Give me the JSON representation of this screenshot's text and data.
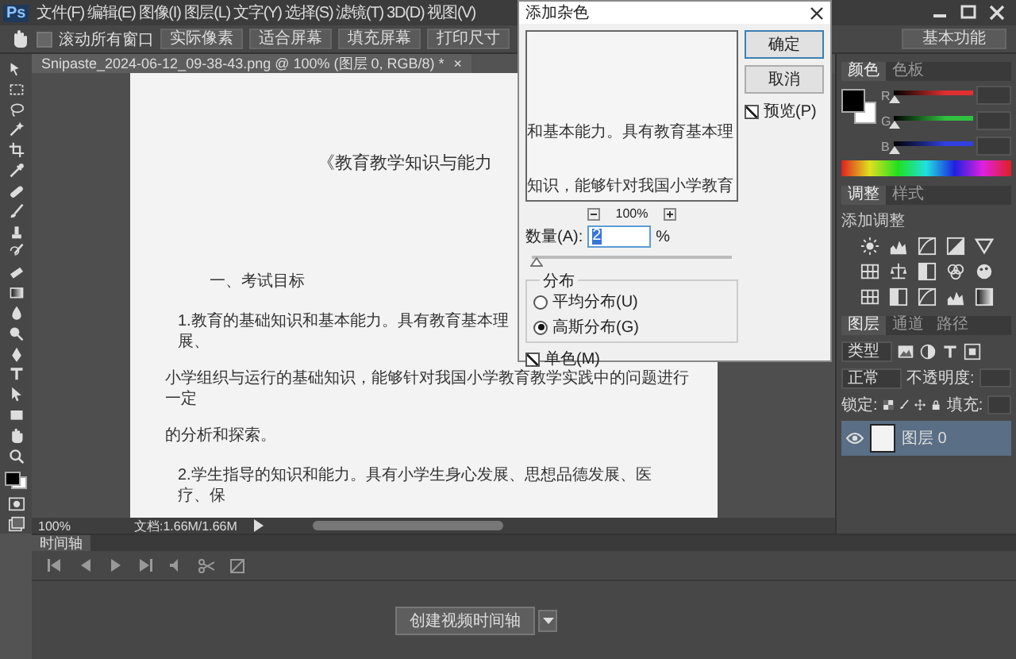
{
  "app": {
    "logo": "Ps"
  },
  "menu": [
    "文件(F)",
    "编辑(E)",
    "图像(I)",
    "图层(L)",
    "文字(Y)",
    "选择(S)",
    "滤镜(T)",
    "3D(D)",
    "视图(V)"
  ],
  "options": {
    "scroll_all": {
      "label": "滚动所有窗口",
      "checked": false
    },
    "buttons": [
      "实际像素",
      "适合屏幕",
      "填充屏幕",
      "打印尺寸"
    ],
    "workspace": "基本功能"
  },
  "document_tab": {
    "title": "Snipaste_2024-06-12_09-38-43.png @ 100% (图层 0, RGB/8) *",
    "close": "×"
  },
  "document": {
    "lines": [
      {
        "kind": "title",
        "text": "《教育教学知识与能力"
      },
      {
        "kind": "heading",
        "text": "一、考试目标"
      },
      {
        "kind": "item",
        "text": "1.教育的基础知识和基本能力。具有教育基本理"
      },
      {
        "kind": "wrap",
        "text": "展、"
      },
      {
        "kind": "body",
        "text": "小学组织与运行的基础知识，能够针对我国小学教育教学实践中的问题进行"
      },
      {
        "kind": "body_wrap",
        "text": "一定"
      },
      {
        "kind": "body",
        "text": "的分析和探索。"
      },
      {
        "kind": "item",
        "text": "2.学生指导的知识和能力。具有小学生身心发展、思想品德发展、医"
      },
      {
        "kind": "wrap",
        "text": "疗、保"
      }
    ]
  },
  "status_bar": {
    "zoom": "100%",
    "doc_size": "文档:1.66M/1.66M"
  },
  "dialog": {
    "title": "添加杂色",
    "preview_lines": [
      "和基本能力。具有教育基本理",
      "知识，能够针对我国小学教育"
    ],
    "preview_zoom": "100%",
    "amount": {
      "label": "数量(A):",
      "value": "2",
      "unit": "%",
      "level": 0.02
    },
    "distribution": {
      "legend": "分布",
      "options": [
        {
          "label": "平均分布(U)",
          "selected": false
        },
        {
          "label": "高斯分布(G)",
          "selected": true
        }
      ]
    },
    "monochrome": {
      "label": "单色(M)",
      "checked": true
    },
    "preview": {
      "label": "预览(P)",
      "checked": true
    },
    "buttons": [
      {
        "label": "确定",
        "default": true
      },
      {
        "label": "取消",
        "default": false
      }
    ]
  },
  "color_panel": {
    "tabs": [
      {
        "label": "颜色",
        "selected": true
      },
      {
        "label": "色板",
        "selected": false
      }
    ],
    "channels": [
      {
        "name": "R",
        "color": "#e03030",
        "level": 0
      },
      {
        "name": "G",
        "color": "#30c040",
        "level": 0
      },
      {
        "name": "B",
        "color": "#3040e0",
        "level": 0
      }
    ]
  },
  "adjustments_panel": {
    "tabs": [
      {
        "label": "调整",
        "selected": true
      },
      {
        "label": "样式",
        "selected": false
      }
    ],
    "title": "添加调整"
  },
  "layers_panel": {
    "tabs": [
      {
        "label": "图层",
        "selected": true
      },
      {
        "label": "通道",
        "selected": false
      },
      {
        "label": "路径",
        "selected": false
      }
    ],
    "filter": "类型",
    "blend_mode": "正常",
    "opacity_label": "不透明度:",
    "lock_label": "锁定:",
    "fill_label": "填充:",
    "layers": [
      {
        "name": "图层 0",
        "visible": true,
        "selected": true
      }
    ]
  },
  "timeline": {
    "tab": "时间轴",
    "create_button": "创建视频时间轴"
  }
}
